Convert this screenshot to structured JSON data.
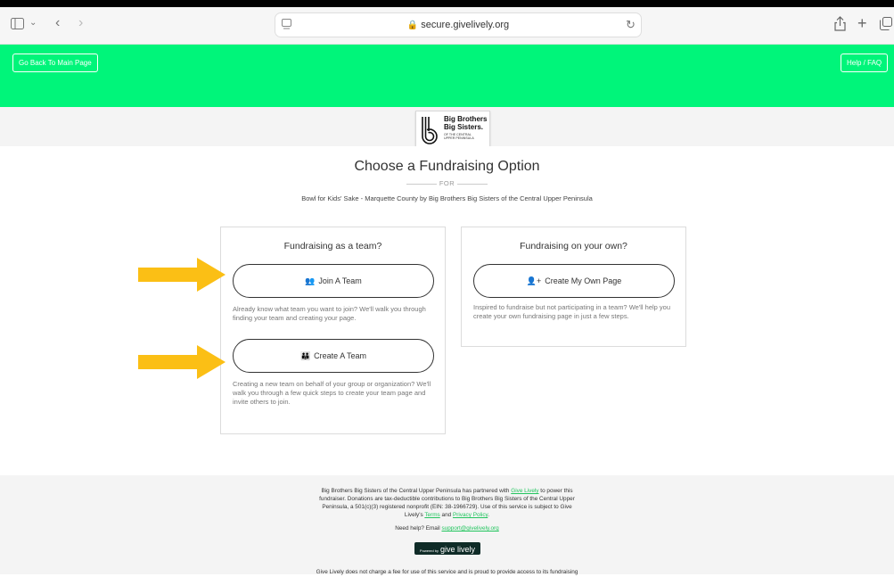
{
  "browser": {
    "url": "secure.givelively.org",
    "icons": [
      "sidebar-icon",
      "chevron-down-icon",
      "back-icon",
      "forward-icon",
      "page-icon",
      "lock-icon",
      "reload-icon",
      "share-icon",
      "plus-icon",
      "tabs-icon"
    ]
  },
  "header": {
    "back_label": "Go Back To Main Page",
    "help_label": "Help / FAQ",
    "color": "#00f57a"
  },
  "logo": {
    "line1": "Big Brothers",
    "line2": "Big Sisters.",
    "line3": "OF THE CENTRAL",
    "line4": "UPPER PENINSULA"
  },
  "main": {
    "title": "Choose a Fundraising Option",
    "for_label": "FOR",
    "subtitle": "Bowl for Kids' Sake - Marquette County by Big Brothers Big Sisters of the Central Upper Peninsula"
  },
  "team_card": {
    "heading": "Fundraising as a team?",
    "join_label": "Join A Team",
    "join_icon": "people-icon",
    "join_desc": "Already know what team you want to join? We'll walk you through finding your team and creating your page.",
    "create_label": "Create A Team",
    "create_icon": "users-icon",
    "create_desc": "Creating a new team on behalf of your group or organization? We'll walk you through a few quick steps to create your team page and invite others to join."
  },
  "own_card": {
    "heading": "Fundraising on your own?",
    "create_label": "Create My Own Page",
    "create_icon": "user-plus-icon",
    "create_desc": "Inspired to fundraise but not participating in a team? We'll help you create your own fundraising page in just a few steps."
  },
  "annotation": {
    "arrow_color": "#fbbf15"
  },
  "footer": {
    "p1_a": "Big Brothers Big Sisters of the Central Upper Peninsula has partnered with",
    "p1_link": "Give Lively",
    "p1_b": "to power this",
    "p2": "fundraiser. Donations are tax-deductible contributions to Big Brothers Big Sisters of the Central Upper",
    "p3": "Peninsula, a 501(c)(3) registered nonprofit (EIN: 38-1966729). Use of this service is subject to Give",
    "p4_a": "Lively's",
    "p4_terms": "Terms",
    "p4_and": "and",
    "p4_privacy": "Privacy Policy",
    "p4_end": ".",
    "help_text": "Need help? Email",
    "help_email": "support@givelively.org",
    "badge_small": "Powered by",
    "badge_big": "give lively",
    "bottom": "Give Lively does not charge a fee for use of this service and is proud to provide access to its fundraising"
  }
}
